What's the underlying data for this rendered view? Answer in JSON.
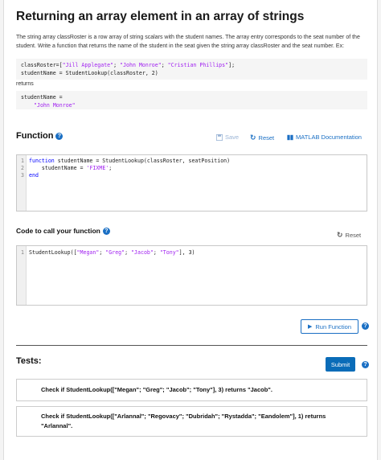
{
  "problem": {
    "title": "Returning an array element in an array of strings",
    "description": "The string array classRoster is a row array of string scalars with the student names.  The array entry corresponds to the seat number of the student. Write a function that returns the name of the student in the seat given the string array classRoster and the seat number. Ex:",
    "example": {
      "line1_prefix": "classRoster=[",
      "line1_s1": "\"Jill Applegate\"",
      "line1_sep1": "; ",
      "line1_s2": "\"John Monroe\"",
      "line1_sep2": ";  ",
      "line1_s3": "\"Cristian Phillips\"",
      "line1_suffix": "];",
      "line2": "studentName = StudentLookup(classRoster, 2)"
    },
    "returns_label": "returns",
    "output": {
      "line1": "studentName =",
      "line2": "\"John Monroe\""
    }
  },
  "function_section": {
    "heading": "Function",
    "save_label": "Save",
    "reset_label": "Reset",
    "docs_label": "MATLAB Documentation",
    "code": {
      "l1_kw": "function",
      "l1_rest": " studentName = StudentLookup(classRoster, seatPosition)",
      "l2_pre": "    studentName = ",
      "l2_str": "'FIXME'",
      "l2_post": ";",
      "l3_kw": "end"
    },
    "line_numbers": [
      "1",
      "2",
      "3"
    ]
  },
  "call_section": {
    "heading": "Code to call your function",
    "reset_label": "Reset",
    "line_numbers": [
      "1"
    ],
    "code": {
      "pre": "StudentLookup([",
      "s1": "\"Megan\"",
      "sep1": "; ",
      "s2": "\"Greg\"",
      "sep2": "; ",
      "s3": "\"Jacob\"",
      "sep3": "; ",
      "s4": "\"Tony\"",
      "post": "], 3)"
    },
    "run_label": "Run Function"
  },
  "tests_section": {
    "heading": "Tests:",
    "submit_label": "Submit",
    "tests": [
      "Check if StudentLookup([\"Megan\"; \"Greg\"; \"Jacob\"; \"Tony\"], 3) returns \"Jacob\".",
      "Check if StudentLookup([\"Arlannal\"; \"Regovacy\"; \"Dubridah\"; \"Rystadda\"; \"Eandolem\"], 1) returns \"Arlannal\"."
    ]
  },
  "colors": {
    "accent": "#1a6fc4",
    "submit": "#0a6cb8",
    "string": "#a020f0",
    "keyword": "#0000ff"
  }
}
